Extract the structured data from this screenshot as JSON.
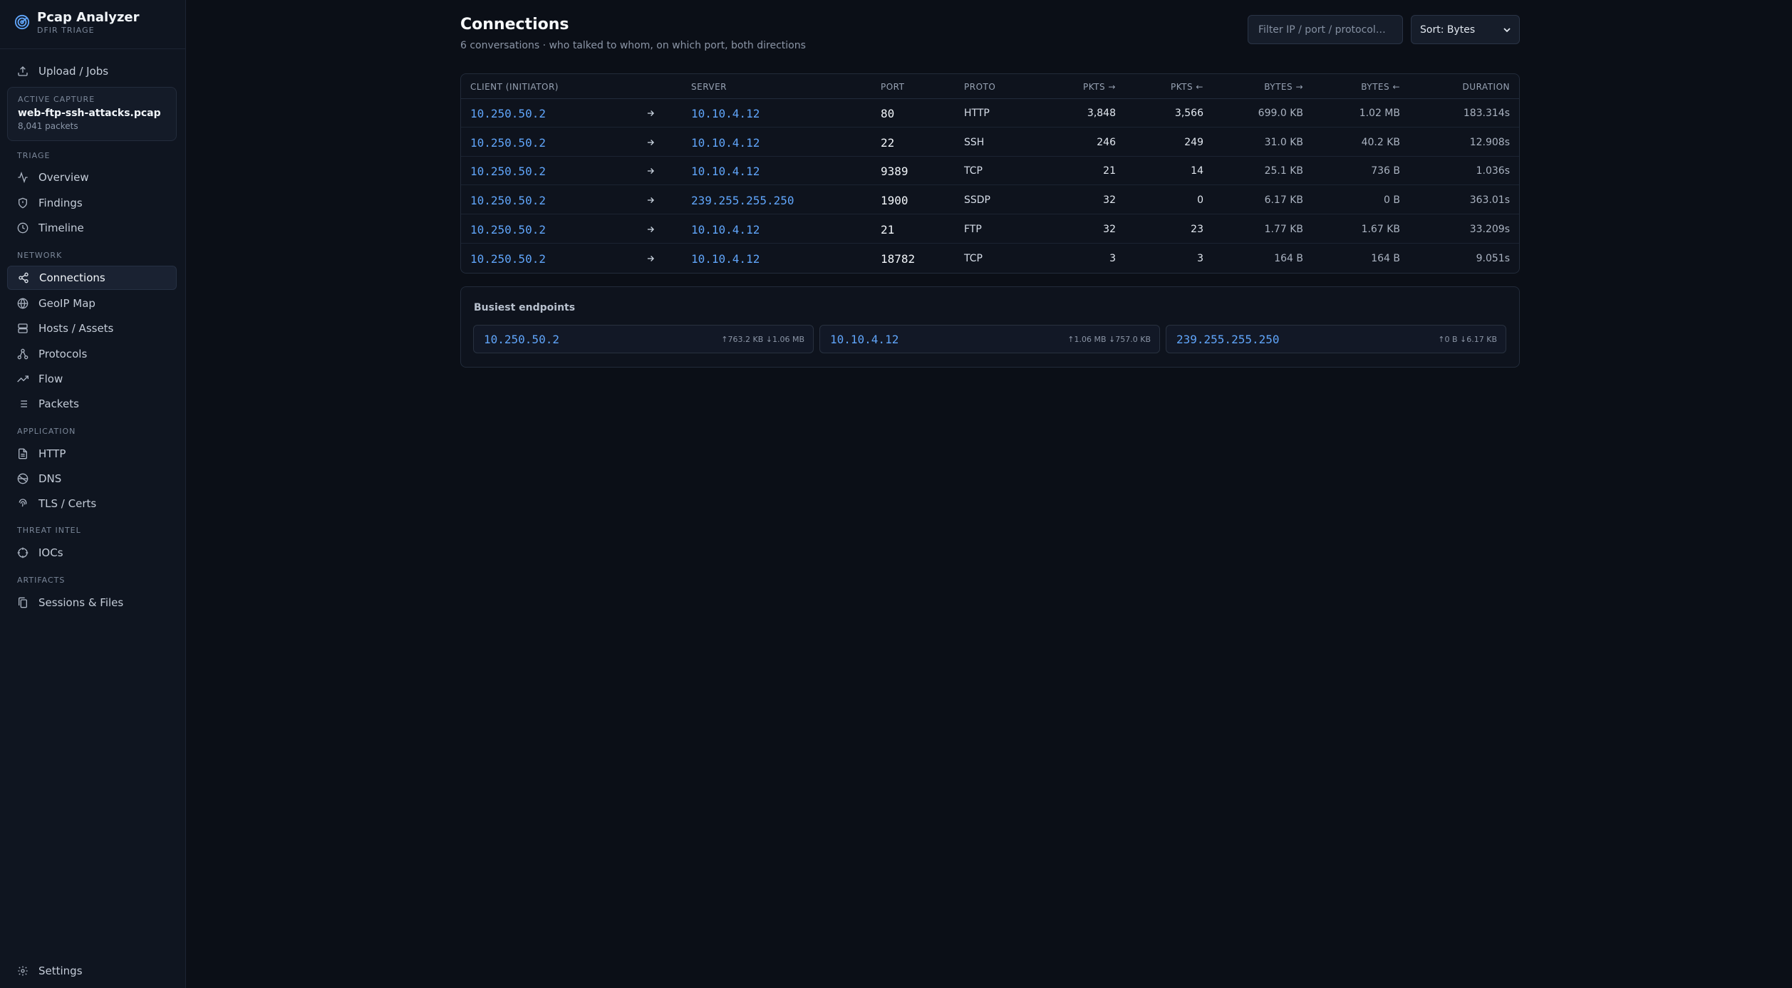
{
  "app": {
    "title": "Pcap Analyzer",
    "subtitle": "DFIR TRIAGE"
  },
  "sidebar": {
    "upload": "Upload / Jobs",
    "capture": {
      "label": "ACTIVE CAPTURE",
      "name": "web-ftp-ssh-attacks.pcap",
      "packets": "8,041 packets"
    },
    "sections": {
      "triage": "TRIAGE",
      "network": "NETWORK",
      "application": "APPLICATION",
      "threat_intel": "THREAT INTEL",
      "artifacts": "ARTIFACTS"
    },
    "items": {
      "overview": "Overview",
      "findings": "Findings",
      "timeline": "Timeline",
      "connections": "Connections",
      "geoip": "GeoIP Map",
      "hosts": "Hosts / Assets",
      "protocols": "Protocols",
      "flow": "Flow",
      "packets": "Packets",
      "http": "HTTP",
      "dns": "DNS",
      "tls": "TLS / Certs",
      "iocs": "IOCs",
      "sessions": "Sessions & Files",
      "settings": "Settings"
    },
    "active": "connections"
  },
  "main": {
    "title": "Connections",
    "subtitle": "6 conversations · who talked to whom, on which port, both directions",
    "filter_placeholder": "Filter IP / port / protocol…",
    "sort_label": "Sort: Bytes"
  },
  "table": {
    "headers": {
      "client": "CLIENT (INITIATOR)",
      "server": "SERVER",
      "port": "PORT",
      "proto": "PROTO",
      "pkts_out": "PKTS →",
      "pkts_in": "PKTS ←",
      "bytes_out": "BYTES →",
      "bytes_in": "BYTES ←",
      "duration": "DURATION"
    },
    "rows": [
      {
        "client": "10.250.50.2",
        "server": "10.10.4.12",
        "port": "80",
        "proto": "HTTP",
        "pkts_out": "3,848",
        "pkts_in": "3,566",
        "bytes_out": "699.0 KB",
        "bytes_in": "1.02 MB",
        "duration": "183.314s"
      },
      {
        "client": "10.250.50.2",
        "server": "10.10.4.12",
        "port": "22",
        "proto": "SSH",
        "pkts_out": "246",
        "pkts_in": "249",
        "bytes_out": "31.0 KB",
        "bytes_in": "40.2 KB",
        "duration": "12.908s"
      },
      {
        "client": "10.250.50.2",
        "server": "10.10.4.12",
        "port": "9389",
        "proto": "TCP",
        "pkts_out": "21",
        "pkts_in": "14",
        "bytes_out": "25.1 KB",
        "bytes_in": "736 B",
        "duration": "1.036s"
      },
      {
        "client": "10.250.50.2",
        "server": "239.255.255.250",
        "port": "1900",
        "proto": "SSDP",
        "pkts_out": "32",
        "pkts_in": "0",
        "bytes_out": "6.17 KB",
        "bytes_in": "0 B",
        "duration": "363.01s"
      },
      {
        "client": "10.250.50.2",
        "server": "10.10.4.12",
        "port": "21",
        "proto": "FTP",
        "pkts_out": "32",
        "pkts_in": "23",
        "bytes_out": "1.77 KB",
        "bytes_in": "1.67 KB",
        "duration": "33.209s"
      },
      {
        "client": "10.250.50.2",
        "server": "10.10.4.12",
        "port": "18782",
        "proto": "TCP",
        "pkts_out": "3",
        "pkts_in": "3",
        "bytes_out": "164 B",
        "bytes_in": "164 B",
        "duration": "9.051s"
      }
    ]
  },
  "endpoints": {
    "title": "Busiest endpoints",
    "items": [
      {
        "ip": "10.250.50.2",
        "stats": "↑763.2 KB ↓1.06 MB"
      },
      {
        "ip": "10.10.4.12",
        "stats": "↑1.06 MB ↓757.0 KB"
      },
      {
        "ip": "239.255.255.250",
        "stats": "↑0 B ↓6.17 KB"
      }
    ]
  },
  "colors": {
    "accent": "#60a5fa",
    "background": "#0b0f17",
    "sidebar": "#0f1520"
  }
}
